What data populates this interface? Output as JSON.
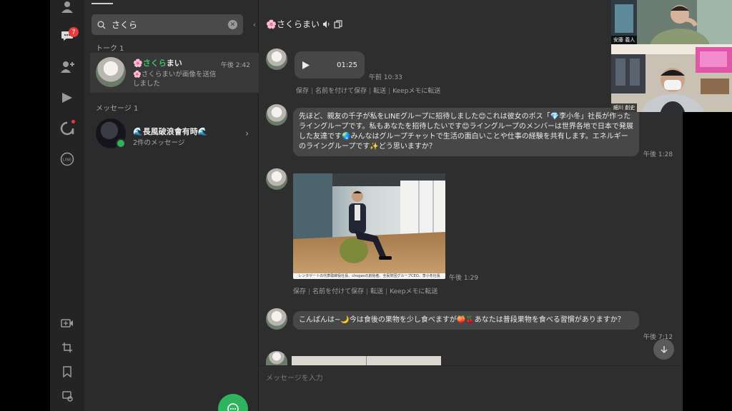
{
  "rail": {
    "chat_badge": "7"
  },
  "list": {
    "search_value": "さくら",
    "sections": {
      "talk": "トーク 1",
      "messages": "メッセージ 1"
    },
    "talk_item": {
      "name_prefix": "🌸",
      "name_highlight": "さくら",
      "name_rest": "まい",
      "time": "午後 2:42",
      "preview": "🌸さくらまいが画像を送信しました"
    },
    "message_item": {
      "name": "🌊長風破浪會有時🌊",
      "preview": "2件のメッセージ"
    }
  },
  "chat": {
    "title": "🌸さくらまい",
    "messages": [
      {
        "type": "voice",
        "duration": "01:25",
        "time": "午前 10:33"
      },
      {
        "type": "text",
        "text": "先ほど、親友の千子が私をLINEグループに招待しました😊これは彼女のボス「💎李小冬」社長が作ったライングループです。私もあなたを招待したいです😊ライングループのメンバーは世界各地で日本で発展した友達です🌏みんなはグループチャットで生活の面白いことや仕事の経験を共有します。エネルギーのライングループです✨どう思いますか？",
        "time": "午後 1:28"
      },
      {
        "type": "image",
        "caption": "レンタゲートの代表取締役社長、chogaoの創始者、全民財団グループCEO、李小冬社長",
        "time": "午後 1:29"
      },
      {
        "type": "text",
        "text": "こんばんは~🌙今は食後の果物を少し食べますが🍑🍒あなたは普段果物を食べる習慣がありますか？",
        "time": "午後 7:12"
      }
    ],
    "actions": [
      "保存",
      "名前を付けて保存",
      "転送",
      "Keepメモに転送"
    ],
    "composer_placeholder": "メッセージを入力"
  },
  "video": {
    "top_name": "安藤 義人",
    "bottom_name": "細川 創史"
  },
  "colors": {
    "accent": "#2fb35f",
    "badge": "#e63c3c",
    "bubble": "#474747",
    "chat_bg": "#2e2e2e",
    "list_bg": "#2b2b2b",
    "rail_bg": "#242424"
  }
}
